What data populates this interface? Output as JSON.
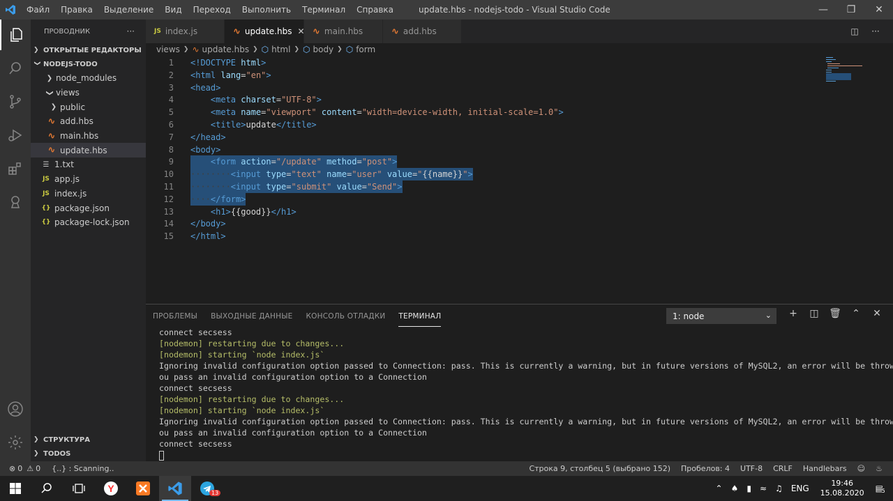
{
  "titlebar": {
    "menu": [
      "Файл",
      "Правка",
      "Выделение",
      "Вид",
      "Переход",
      "Выполнить",
      "Терминал",
      "Справка"
    ],
    "title": "update.hbs - nodejs-todo - Visual Studio Code"
  },
  "sidebar": {
    "title": "ПРОВОДНИК",
    "more": "···",
    "open_editors": "ОТКРЫТЫЕ РЕДАКТОРЫ",
    "project": "NODEJS-TODO",
    "tree": [
      {
        "label": "node_modules",
        "type": "folder",
        "indent": 1,
        "open": false
      },
      {
        "label": "views",
        "type": "folder",
        "indent": 1,
        "open": true
      },
      {
        "label": "public",
        "type": "folder",
        "indent": 2,
        "open": false
      },
      {
        "label": "add.hbs",
        "type": "hbs",
        "indent": 2
      },
      {
        "label": "main.hbs",
        "type": "hbs",
        "indent": 2
      },
      {
        "label": "update.hbs",
        "type": "hbs",
        "indent": 2,
        "selected": true
      },
      {
        "label": "1.txt",
        "type": "txt",
        "indent": 1
      },
      {
        "label": "app.js",
        "type": "js",
        "indent": 1
      },
      {
        "label": "index.js",
        "type": "js",
        "indent": 1
      },
      {
        "label": "package.json",
        "type": "json",
        "indent": 1
      },
      {
        "label": "package-lock.json",
        "type": "json",
        "indent": 1
      }
    ],
    "outline": "СТРУКТУРА",
    "todos": "TODOS"
  },
  "tabs": [
    {
      "label": "index.js",
      "icon": "JS",
      "active": false
    },
    {
      "label": "update.hbs",
      "icon": "hbs",
      "active": true
    },
    {
      "label": "main.hbs",
      "icon": "hbs",
      "active": false
    },
    {
      "label": "add.hbs",
      "icon": "hbs",
      "active": false
    }
  ],
  "breadcrumb": [
    "views",
    "update.hbs",
    "html",
    "body",
    "form"
  ],
  "editor": {
    "lines": [
      [
        [
          "tg",
          "<!DOCTYPE "
        ],
        [
          "at",
          "html"
        ],
        [
          "tg",
          ">"
        ]
      ],
      [
        [
          "tg",
          "<html "
        ],
        [
          "at",
          "lang"
        ],
        [
          "tx",
          "="
        ],
        [
          "st",
          "\"en\""
        ],
        [
          "tg",
          ">"
        ]
      ],
      [
        [
          "tg",
          "<head>"
        ]
      ],
      [
        [
          "tb",
          "    "
        ],
        [
          "tg",
          "<meta "
        ],
        [
          "at",
          "charset"
        ],
        [
          "tx",
          "="
        ],
        [
          "st",
          "\"UTF-8\""
        ],
        [
          "tg",
          ">"
        ]
      ],
      [
        [
          "tb",
          "    "
        ],
        [
          "tg",
          "<meta "
        ],
        [
          "at",
          "name"
        ],
        [
          "tx",
          "="
        ],
        [
          "st",
          "\"viewport\" "
        ],
        [
          "at",
          "content"
        ],
        [
          "tx",
          "="
        ],
        [
          "st",
          "\"width=device-width, initial-scale=1.0\""
        ],
        [
          "tg",
          ">"
        ]
      ],
      [
        [
          "tb",
          "    "
        ],
        [
          "tg",
          "<title>"
        ],
        [
          "tx",
          "update"
        ],
        [
          "tg",
          "</title>"
        ]
      ],
      [
        [
          "tg",
          "</head>"
        ]
      ],
      [
        [
          "tg",
          "<body>"
        ]
      ],
      [
        [
          "tb",
          "    "
        ],
        [
          "tg",
          "<form "
        ],
        [
          "at",
          "action"
        ],
        [
          "tx",
          "="
        ],
        [
          "st",
          "\"/update\" "
        ],
        [
          "at",
          "method"
        ],
        [
          "tx",
          "="
        ],
        [
          "st",
          "\"post\""
        ],
        [
          "tg",
          ">"
        ]
      ],
      [
        [
          "tb",
          "········"
        ],
        [
          "tg",
          "<input "
        ],
        [
          "at",
          "type"
        ],
        [
          "tx",
          "="
        ],
        [
          "st",
          "\"text\" "
        ],
        [
          "at",
          "name"
        ],
        [
          "tx",
          "="
        ],
        [
          "st",
          "\"user\" "
        ],
        [
          "at",
          "value"
        ],
        [
          "tx",
          "="
        ],
        [
          "st",
          "\""
        ],
        [
          "tx",
          "{{name}}"
        ],
        [
          "st",
          "\""
        ],
        [
          "tg",
          ">"
        ]
      ],
      [
        [
          "tb",
          "········"
        ],
        [
          "tg",
          "<input "
        ],
        [
          "at",
          "type"
        ],
        [
          "tx",
          "="
        ],
        [
          "st",
          "\"submit\" "
        ],
        [
          "at",
          "value"
        ],
        [
          "tx",
          "="
        ],
        [
          "st",
          "\"Send\""
        ],
        [
          "tg",
          ">"
        ]
      ],
      [
        [
          "tb",
          "····"
        ],
        [
          "tg",
          "</form>"
        ]
      ],
      [
        [
          "tb",
          "    "
        ],
        [
          "tg",
          "<h1>"
        ],
        [
          "tx",
          "{{good}}"
        ],
        [
          "tg",
          "</h1>"
        ]
      ],
      [
        [
          "tg",
          "</body>"
        ]
      ],
      [
        [
          "tg",
          "</html>"
        ]
      ]
    ]
  },
  "panel": {
    "tabs": [
      "ПРОБЛЕМЫ",
      "ВЫХОДНЫЕ ДАННЫЕ",
      "КОНСОЛЬ ОТЛАДКИ",
      "ТЕРМИНАЛ"
    ],
    "active_tab": 3,
    "terminal_select": "1: node",
    "terminal": [
      [
        "",
        "connect secsess"
      ],
      [
        "g",
        "[nodemon] restarting due to changes..."
      ],
      [
        "g",
        "[nodemon] starting `node index.js`"
      ],
      [
        "",
        "Ignoring invalid configuration option passed to Connection: pass. This is currently a warning, but in future versions of MySQL2, an error will be thrown if y"
      ],
      [
        "",
        "ou pass an invalid configuration option to a Connection"
      ],
      [
        "",
        "connect secsess"
      ],
      [
        "g",
        "[nodemon] restarting due to changes..."
      ],
      [
        "g",
        "[nodemon] starting `node index.js`"
      ],
      [
        "",
        "Ignoring invalid configuration option passed to Connection: pass. This is currently a warning, but in future versions of MySQL2, an error will be thrown if y"
      ],
      [
        "",
        "ou pass an invalid configuration option to a Connection"
      ],
      [
        "",
        "connect secsess"
      ]
    ]
  },
  "statusbar": {
    "errors": "0",
    "warnings": "0",
    "scanning": "{..} : Scanning..",
    "position": "Строка 9, столбец 5 (выбрано 152)",
    "spaces": "Пробелов: 4",
    "encoding": "UTF-8",
    "eol": "CRLF",
    "language": "Handlebars"
  },
  "taskbar": {
    "lang": "ENG",
    "time": "19:46",
    "date": "15.08.2020",
    "telegram_badge": "13",
    "notif_badge": "5"
  }
}
